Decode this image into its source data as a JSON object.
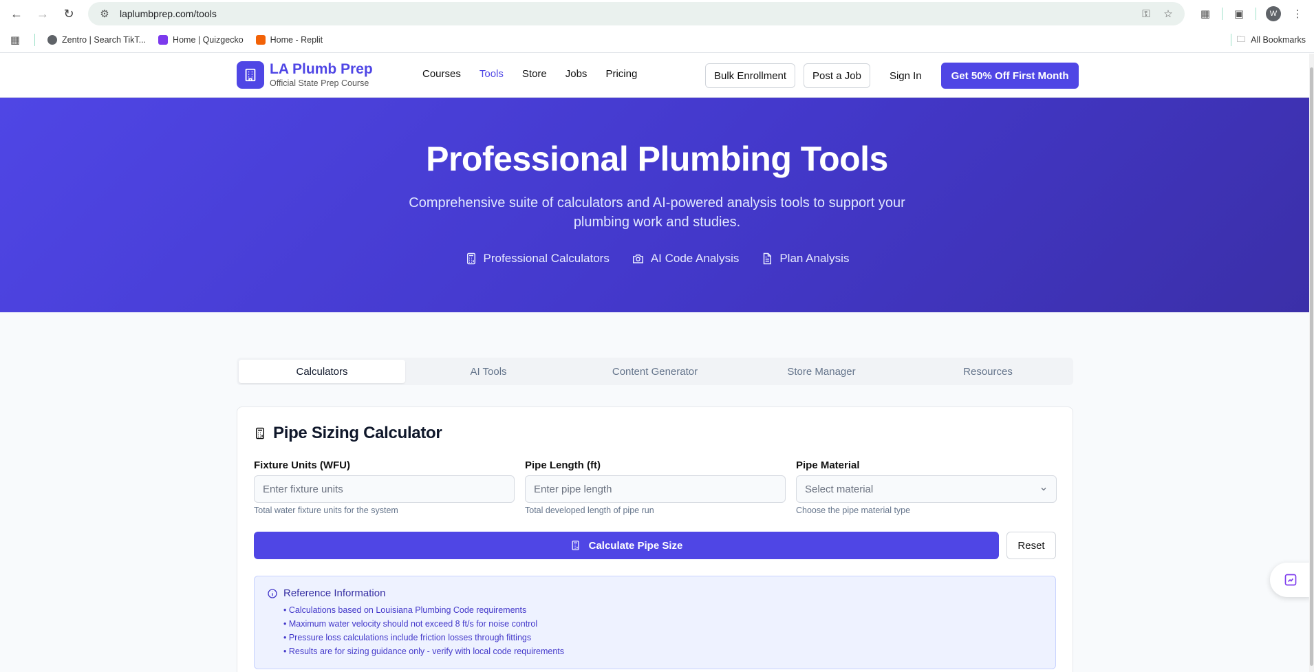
{
  "browser": {
    "url": "laplumbprep.com/tools",
    "bookmarks": [
      {
        "label": "Zentro | Search TikT...",
        "color": "#5f6368"
      },
      {
        "label": "Home | Quizgecko",
        "color": "#7c3aed"
      },
      {
        "label": "Home - Replit",
        "color": "#f26207"
      }
    ],
    "all_bookmarks": "All Bookmarks",
    "profile_initial": "W"
  },
  "header": {
    "brand_title": "LA Plumb Prep",
    "brand_subtitle": "Official State Prep Course",
    "nav": [
      "Courses",
      "Tools",
      "Store",
      "Jobs",
      "Pricing"
    ],
    "active_nav": "Tools",
    "bulk_enrollment": "Bulk Enrollment",
    "post_job": "Post a Job",
    "sign_in": "Sign In",
    "cta": "Get 50% Off First Month"
  },
  "hero": {
    "title": "Professional Plumbing Tools",
    "subtitle": "Comprehensive suite of calculators and AI-powered analysis tools to support your plumbing work and studies.",
    "features": [
      {
        "icon": "calculator-icon",
        "label": "Professional Calculators"
      },
      {
        "icon": "camera-icon",
        "label": "AI Code Analysis"
      },
      {
        "icon": "document-icon",
        "label": "Plan Analysis"
      }
    ]
  },
  "tabs": [
    "Calculators",
    "AI Tools",
    "Content Generator",
    "Store Manager",
    "Resources"
  ],
  "active_tab": "Calculators",
  "calculator": {
    "title": "Pipe Sizing Calculator",
    "fields": [
      {
        "label": "Fixture Units (WFU)",
        "placeholder": "Enter fixture units",
        "help": "Total water fixture units for the system"
      },
      {
        "label": "Pipe Length (ft)",
        "placeholder": "Enter pipe length",
        "help": "Total developed length of pipe run"
      },
      {
        "label": "Pipe Material",
        "placeholder": "Select material",
        "help": "Choose the pipe material type"
      }
    ],
    "calculate_label": "Calculate Pipe Size",
    "reset_label": "Reset",
    "reference": {
      "title": "Reference Information",
      "items": [
        "• Calculations based on Louisiana Plumbing Code requirements",
        "• Maximum water velocity should not exceed 8 ft/s for noise control",
        "• Pressure loss calculations include friction losses through fittings",
        "• Results are for sizing guidance only - verify with local code requirements"
      ]
    }
  },
  "colors": {
    "accent": "#4f46e5",
    "hero_end": "#3b2fa8"
  }
}
